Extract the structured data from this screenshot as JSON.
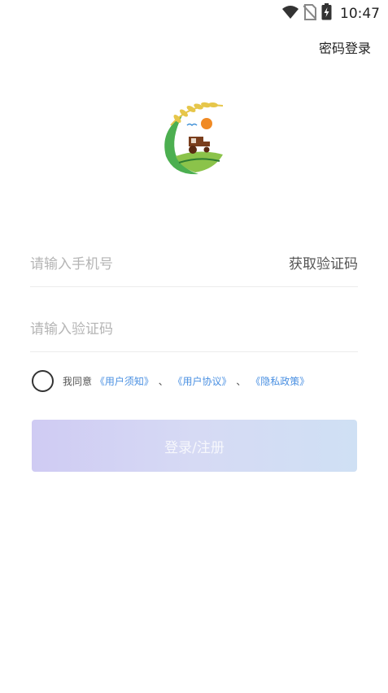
{
  "status_bar": {
    "time": "10:47",
    "icons": [
      "wifi-icon",
      "no-sim-icon",
      "battery-charging-icon"
    ]
  },
  "header": {
    "password_login_label": "密码登录"
  },
  "logo": {
    "icon": "farm-tractor-logo",
    "colors": {
      "green": "#4caf50",
      "wheat": "#e6c64a",
      "sun": "#f08a24",
      "tractor": "#7a3e1d"
    }
  },
  "form": {
    "phone_placeholder": "请输入手机号",
    "get_code_label": "获取验证码",
    "code_placeholder": "请输入验证码"
  },
  "agreement": {
    "prefix": "我同意",
    "user_notice": "《用户须知》",
    "sep1": "、",
    "user_agreement": "《用户协议》",
    "sep2": "、",
    "privacy_policy": "《隐私政策》",
    "link_color": "#4a90e2"
  },
  "submit": {
    "label": "登录/注册"
  }
}
